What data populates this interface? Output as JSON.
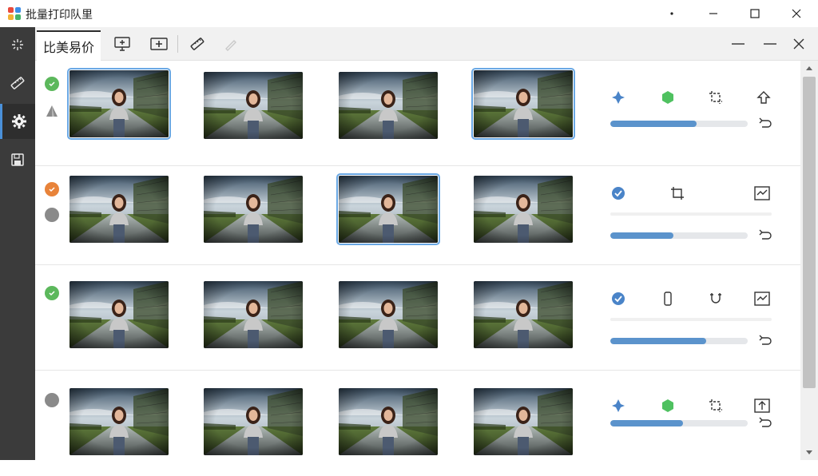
{
  "window": {
    "title": "批量打印队里",
    "controls": [
      "dot-icon",
      "minimize-icon",
      "maximize-icon",
      "close-icon"
    ]
  },
  "sidebar": {
    "items": [
      {
        "name": "sparkle-icon",
        "active": false
      },
      {
        "name": "ruler-icon",
        "active": false
      },
      {
        "name": "gear-icon",
        "active": true
      },
      {
        "name": "save-icon",
        "active": false
      }
    ]
  },
  "toolbar": {
    "active_tab": "比美易价",
    "icons": [
      "monitor-add-icon",
      "screen-add-icon",
      "ruler-icon",
      "pen-icon"
    ],
    "right_icons": [
      "dash-icon",
      "minimize-icon",
      "close-icon"
    ]
  },
  "colors": {
    "accent": "#5b93cc",
    "success": "#5cb85c",
    "warning": "#e8833a",
    "neutral": "#8a8a8a",
    "selected_outline": "#6aa8e4"
  },
  "rows": [
    {
      "status": [
        "success",
        "warning-triangle"
      ],
      "selected_thumbs": [
        0,
        3
      ],
      "actions": [
        "pin-icon",
        "hexagon-icon",
        "crop-icon",
        "upload-icon"
      ],
      "progress": 0.63,
      "extra_action": "undo-icon"
    },
    {
      "status": [
        "warning",
        "neutral"
      ],
      "selected_thumbs": [
        2
      ],
      "actions": [
        "check-icon",
        "crop-icon",
        "chart-icon"
      ],
      "progress": 0.46,
      "extra_action": "undo-icon"
    },
    {
      "status": [
        "success"
      ],
      "selected_thumbs": [],
      "actions": [
        "check-icon",
        "phone-icon",
        "magnet-icon",
        "chart-icon"
      ],
      "progress": 0.7,
      "extra_action": "undo-icon"
    },
    {
      "status": [
        "neutral"
      ],
      "selected_thumbs": [],
      "actions": [
        "pin-icon",
        "hexagon-icon",
        "crop-icon",
        "upload-box-icon"
      ],
      "progress": 0.53,
      "extra_action": "undo-icon"
    }
  ]
}
